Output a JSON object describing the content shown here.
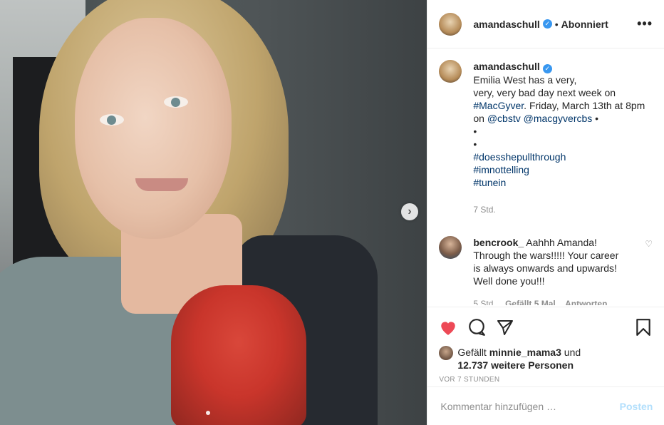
{
  "header": {
    "username": "amandaschull",
    "separator": "•",
    "follow_status": "Abonniert",
    "more": "•••"
  },
  "caption": {
    "username": "amandaschull",
    "lines": [
      "Emilia West has a very,",
      "very, very bad day next week on",
      "#MacGyver",
      ". Friday, March 13th at 8pm",
      "on ",
      "@cbstv",
      "@macgyvercbs",
      " •",
      "•",
      "•",
      "#doesshepullthrough",
      "#imnottelling",
      "#tunein"
    ],
    "time": "7 Std."
  },
  "comment": {
    "username": "bencrook_",
    "text_lines": [
      "Aahhh Amanda!",
      "Through the wars!!!!! Your career",
      "is always onwards and upwards!",
      "Well done you!!!"
    ],
    "time": "5 Std.",
    "likes": "Gefällt 5 Mal",
    "reply": "Antworten"
  },
  "likes": {
    "prefix": "Gefällt ",
    "user": "minnie_mama3",
    "connector": " und",
    "others": "12.737 weitere Personen"
  },
  "posted": "VOR 7 STUNDEN",
  "add_comment": {
    "placeholder": "Kommentar hinzufügen …",
    "post_label": "Posten"
  },
  "media": {
    "next": "›"
  }
}
